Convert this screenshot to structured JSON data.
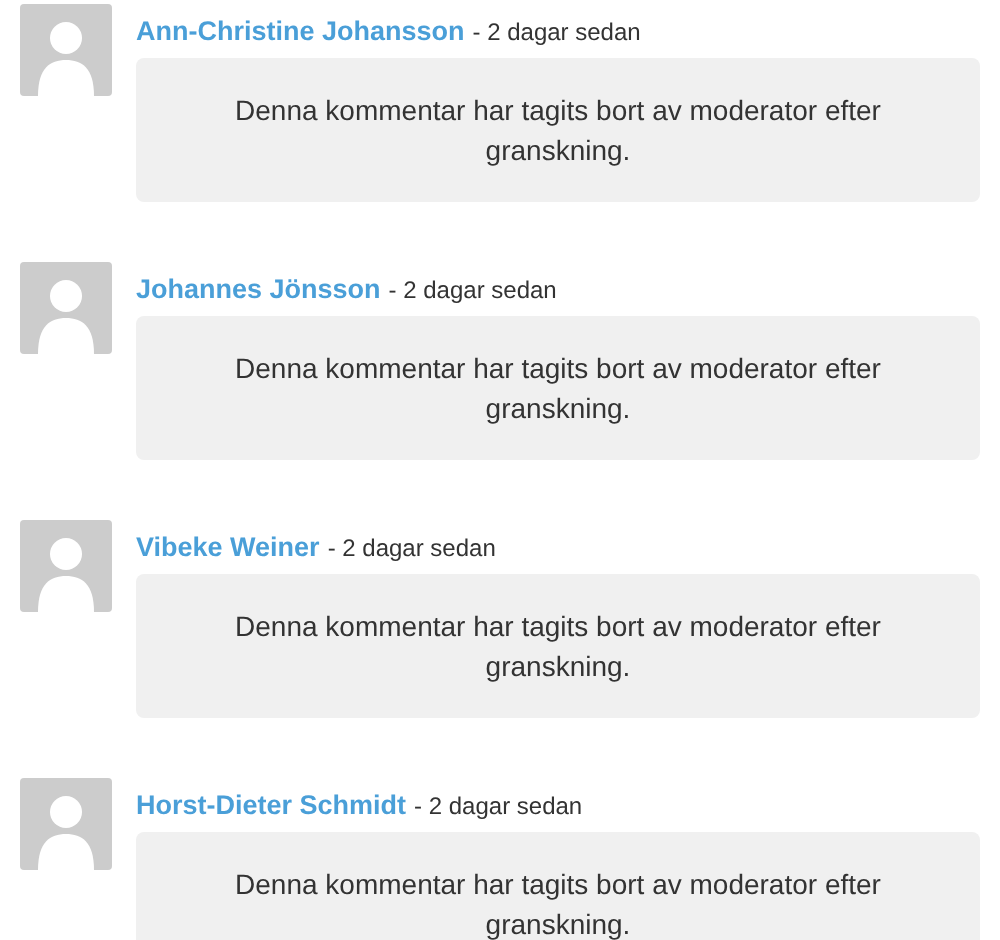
{
  "comments": [
    {
      "author": "Ann-Christine Johansson",
      "time": "- 2 dagar sedan",
      "message": "Denna kommentar har tagits bort av moderator efter granskning."
    },
    {
      "author": "Johannes Jönsson",
      "time": "- 2 dagar sedan",
      "message": "Denna kommentar har tagits bort av moderator efter granskning."
    },
    {
      "author": "Vibeke Weiner",
      "time": "- 2 dagar sedan",
      "message": "Denna kommentar har tagits bort av moderator efter granskning."
    },
    {
      "author": "Horst-Dieter Schmidt",
      "time": "- 2 dagar sedan",
      "message": "Denna kommentar har tagits bort av moderator efter granskning."
    }
  ]
}
